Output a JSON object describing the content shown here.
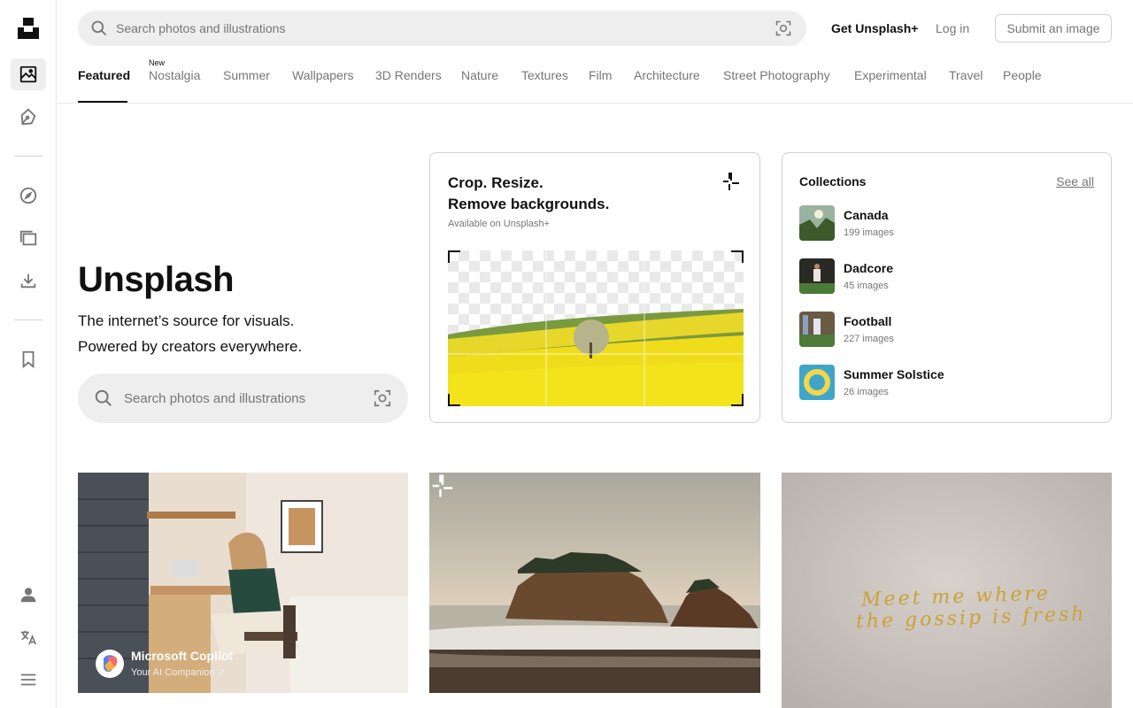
{
  "header": {
    "search_placeholder": "Search photos and illustrations",
    "get_plus": "Get Unsplash+",
    "login": "Log in",
    "submit": "Submit an image"
  },
  "sidebar": {
    "items": [
      {
        "icon": "photos-icon",
        "active": true
      },
      {
        "icon": "illustrations-pen-icon"
      },
      {
        "icon": "explore-compass-icon"
      },
      {
        "icon": "collections-icon"
      },
      {
        "icon": "download-icon"
      },
      {
        "icon": "bookmark-icon"
      },
      {
        "icon": "user-icon"
      },
      {
        "icon": "language-icon"
      },
      {
        "icon": "menu-icon"
      }
    ]
  },
  "tabs": [
    {
      "label": "Featured",
      "active": true
    },
    {
      "label": "Nostalgia",
      "badge": "New"
    },
    {
      "label": "Summer"
    },
    {
      "label": "Wallpapers"
    },
    {
      "label": "3D Renders"
    },
    {
      "label": "Nature"
    },
    {
      "label": "Textures"
    },
    {
      "label": "Film"
    },
    {
      "label": "Architecture"
    },
    {
      "label": "Street Photography"
    },
    {
      "label": "Experimental"
    },
    {
      "label": "Travel"
    },
    {
      "label": "People"
    }
  ],
  "hero": {
    "title": "Unsplash",
    "line1": "The internet’s source for visuals.",
    "line2": "Powered by creators everywhere.",
    "search_placeholder": "Search photos and illustrations"
  },
  "plus_card": {
    "title_line1": "Crop. Resize.",
    "title_line2": "Remove backgrounds.",
    "subtitle": "Available on Unsplash+"
  },
  "collections": {
    "title": "Collections",
    "see_all": "See all",
    "items": [
      {
        "name": "Canada",
        "count": "199 images"
      },
      {
        "name": "Dadcore",
        "count": "45 images"
      },
      {
        "name": "Football",
        "count": "227 images"
      },
      {
        "name": "Summer Solstice",
        "count": "26 images"
      }
    ]
  },
  "photos": {
    "ad": {
      "name": "Microsoft Copilot",
      "sub": "Your AI Companion ↗"
    },
    "text_photo_line1": "Meet me where",
    "text_photo_line2": "the gossip is fresh"
  },
  "colors": {
    "text": "#111111",
    "muted": "#767676",
    "border": "#d1d1d1",
    "search_bg": "#eeeeee"
  }
}
